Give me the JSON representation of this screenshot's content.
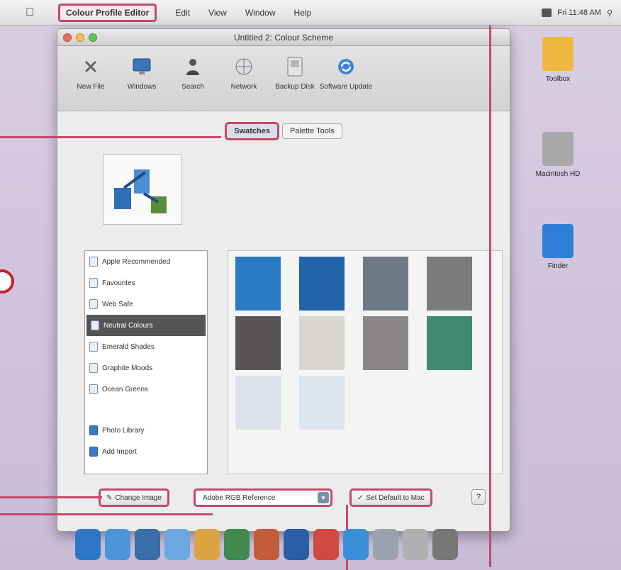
{
  "menubar": {
    "app_name": "Colour Profile Editor",
    "items": [
      "Edit",
      "View",
      "Window",
      "Help"
    ],
    "status": "Fri 11:48 AM"
  },
  "window": {
    "title": "Untitled 2: Colour Scheme",
    "toolbar": [
      {
        "label": "New File",
        "icon": "close-x-icon"
      },
      {
        "label": "Windows",
        "icon": "monitor-icon"
      },
      {
        "label": "Search",
        "icon": "person-icon"
      },
      {
        "label": "Network",
        "icon": "globe-icon"
      },
      {
        "label": "Backup Disk",
        "icon": "disk-icon"
      },
      {
        "label": "Software Update",
        "icon": "refresh-icon"
      }
    ],
    "tabs": [
      {
        "label": "Swatches",
        "active": true
      },
      {
        "label": "Palette Tools",
        "active": false
      }
    ],
    "sources": [
      {
        "label": "Apple Recommended",
        "icon": "doc-icon"
      },
      {
        "label": "Favourites",
        "icon": "doc-icon"
      },
      {
        "label": "Web Safe",
        "icon": "doc-icon"
      },
      {
        "label": "Neutral Colours",
        "icon": "doc-icon",
        "selected": true
      },
      {
        "label": "Emerald Shades",
        "icon": "doc-icon"
      },
      {
        "label": "Graphite Moods",
        "icon": "doc-icon"
      },
      {
        "label": "Ocean Greens",
        "icon": "doc-icon"
      },
      {
        "label": "Photo Library",
        "icon": "folder-icon"
      },
      {
        "label": "Add Import",
        "icon": "folder-icon"
      }
    ],
    "swatch_colors": [
      [
        "#2a7bc4",
        "#5a5555",
        "#dde1ea"
      ],
      [
        "#1f64a8",
        "#d9d6d2",
        "#dce4ee"
      ],
      [
        "#6d7a86",
        "#8a8786",
        ""
      ],
      [
        "#7d7c7c",
        "#3f8a70",
        ""
      ]
    ],
    "bottom": {
      "change_label": "Change Image",
      "select_value": "Adobe RGB Reference",
      "set_default_label": "Set Default to Mac",
      "help": "?"
    }
  },
  "desktop": [
    {
      "label": "Toolbox",
      "color": "#f0b740"
    },
    {
      "label": "Macintosh HD",
      "color": "#a9a9a9"
    },
    {
      "label": "Finder",
      "color": "#2f7fd6"
    }
  ],
  "dock": [
    "#2e77c8",
    "#4b95d8",
    "#3a6ea8",
    "#6ba7e0",
    "#d9a441",
    "#3f8a4c",
    "#c25c3a",
    "#2b5fa5",
    "#d04a44",
    "#3b8fd9",
    "#9aa3ad",
    "#b0b0b0",
    "#777777"
  ],
  "accent": "#c4496b"
}
